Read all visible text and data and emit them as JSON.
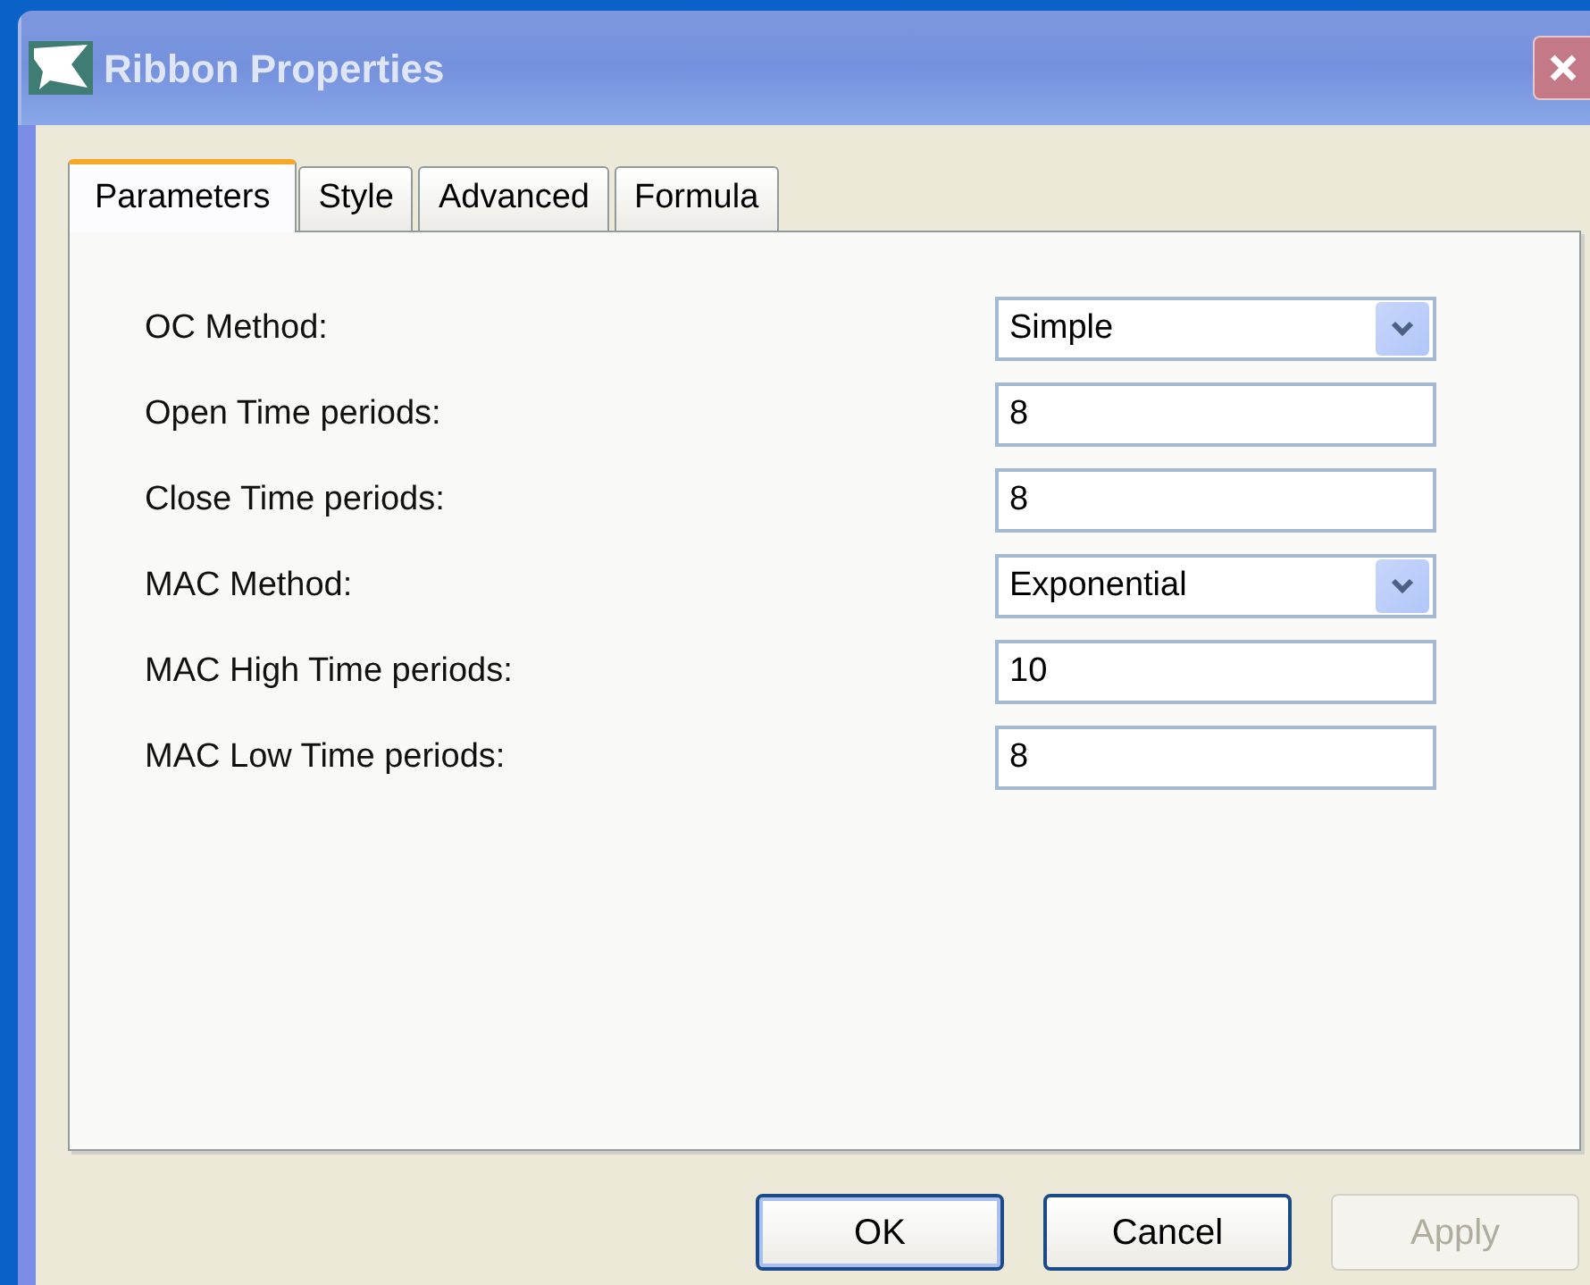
{
  "window": {
    "title": "Ribbon Properties"
  },
  "tabs": [
    {
      "label": "Parameters",
      "selected": true
    },
    {
      "label": "Style",
      "selected": false
    },
    {
      "label": "Advanced",
      "selected": false
    },
    {
      "label": "Formula",
      "selected": false
    }
  ],
  "fields": [
    {
      "label": "OC Method:",
      "kind": "dropdown",
      "value": "Simple"
    },
    {
      "label": "Open Time periods:",
      "kind": "text",
      "value": "8"
    },
    {
      "label": "Close Time periods:",
      "kind": "text",
      "value": "8"
    },
    {
      "label": "MAC Method:",
      "kind": "dropdown",
      "value": "Exponential"
    },
    {
      "label": "MAC High Time periods:",
      "kind": "text",
      "value": "10"
    },
    {
      "label": "MAC Low Time periods:",
      "kind": "text",
      "value": "8"
    }
  ],
  "buttons": [
    {
      "label": "OK",
      "default": true,
      "disabled": false
    },
    {
      "label": "Cancel",
      "default": false,
      "disabled": false
    },
    {
      "label": "Apply",
      "default": false,
      "disabled": true
    }
  ]
}
